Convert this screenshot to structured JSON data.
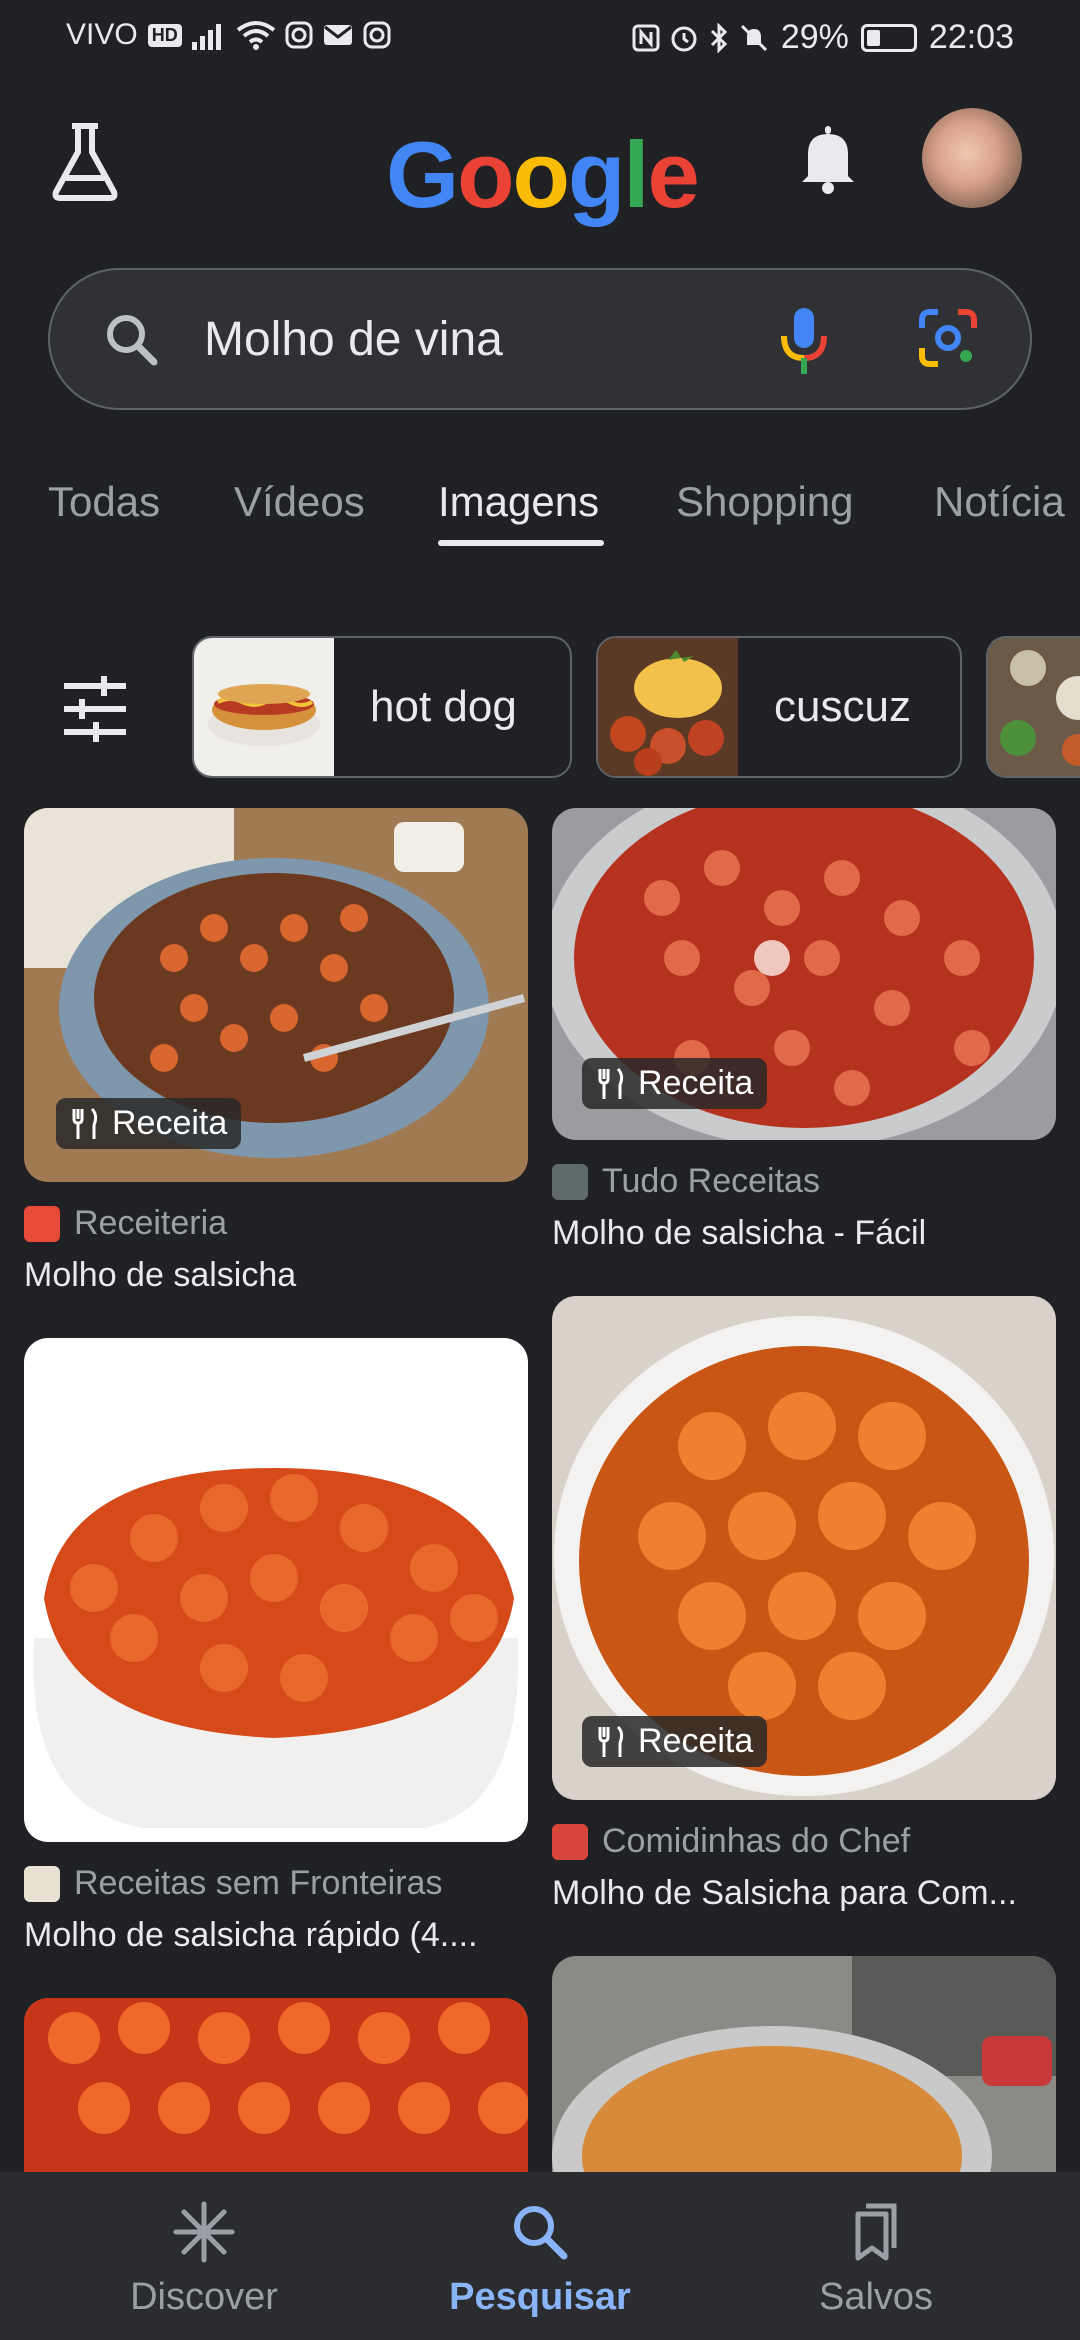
{
  "status_bar": {
    "carrier": "VIVO",
    "hd_badge": "HD",
    "battery": "29%",
    "time": "22:03",
    "battery_level": 0.29
  },
  "header": {
    "logo_text": [
      "G",
      "o",
      "o",
      "g",
      "l",
      "e"
    ],
    "logo_colors": [
      "#4285f4",
      "#ea4335",
      "#fbbc05",
      "#4285f4",
      "#34a853",
      "#ea4335"
    ]
  },
  "search": {
    "query": "Molho de vina"
  },
  "tabs": [
    {
      "label": "Todas"
    },
    {
      "label": "Vídeos"
    },
    {
      "label": "Imagens",
      "active": true
    },
    {
      "label": "Shopping"
    },
    {
      "label": "Notícia"
    }
  ],
  "chips": [
    {
      "label": "hot dog"
    },
    {
      "label": "cuscuz"
    }
  ],
  "results": [
    {
      "badge": "Receita",
      "source": "Receiteria",
      "title": "Molho de salsicha"
    },
    {
      "badge": "Receita",
      "source": "Tudo Receitas",
      "title": "Molho de salsicha - Fácil"
    },
    {
      "badge": "",
      "source": "Receitas sem Fronteiras",
      "title": "Molho de salsicha rápido (4...."
    },
    {
      "badge": "Receita",
      "source": "Comidinhas do Chef",
      "title": "Molho de Salsicha para Com..."
    }
  ],
  "bottom_nav": [
    {
      "label": "Discover"
    },
    {
      "label": "Pesquisar",
      "active": true
    },
    {
      "label": "Salvos"
    }
  ],
  "colors": {
    "background": "#202124",
    "active_nav": "#8ab4f8"
  }
}
